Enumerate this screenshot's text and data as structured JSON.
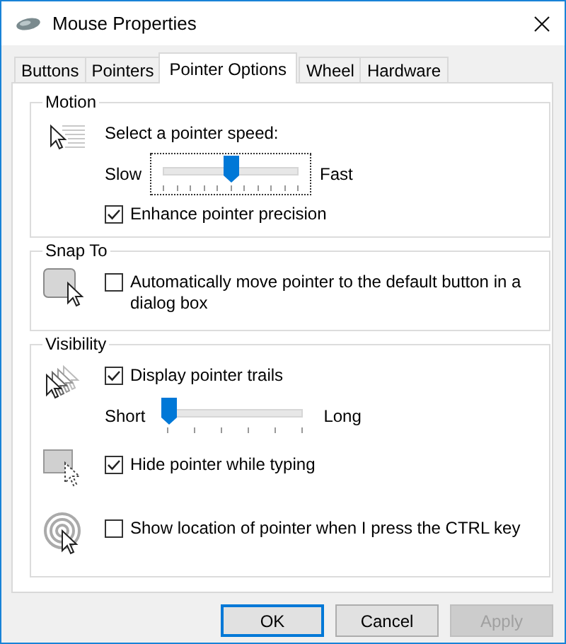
{
  "window": {
    "title": "Mouse Properties"
  },
  "tabs": [
    {
      "label": "Buttons",
      "selected": false
    },
    {
      "label": "Pointers",
      "selected": false
    },
    {
      "label": "Pointer Options",
      "selected": true
    },
    {
      "label": "Wheel",
      "selected": false
    },
    {
      "label": "Hardware",
      "selected": false
    }
  ],
  "groups": [
    {
      "title": "Motion",
      "rows": [
        {
          "controls": [
            {
              "kind": "label",
              "text": "Select a pointer speed:"
            },
            {
              "kind": "slider",
              "min_label": "Slow",
              "max_label": "Fast",
              "level": 0.5,
              "focused": true
            },
            {
              "kind": "checkbox",
              "label": "Enhance pointer precision",
              "checked": true
            }
          ]
        }
      ]
    },
    {
      "title": "Snap To",
      "rows": [
        {
          "controls": [
            {
              "kind": "checkbox",
              "label": "Automatically move pointer to the default button in a dialog box",
              "checked": false
            }
          ]
        }
      ]
    },
    {
      "title": "Visibility",
      "rows": [
        {
          "controls": [
            {
              "kind": "checkbox",
              "label": "Display pointer trails",
              "checked": true
            },
            {
              "kind": "slider",
              "min_label": "Short",
              "max_label": "Long",
              "level": 0,
              "focused": false
            }
          ]
        },
        {
          "controls": [
            {
              "kind": "checkbox",
              "label": "Hide pointer while typing",
              "checked": true
            }
          ]
        },
        {
          "controls": [
            {
              "kind": "checkbox",
              "label": "Show location of pointer when I press the CTRL key",
              "checked": false
            }
          ]
        }
      ]
    }
  ],
  "buttons": [
    {
      "label": "OK",
      "default": true,
      "disabled": false
    },
    {
      "label": "Cancel",
      "default": false,
      "disabled": false
    },
    {
      "label": "Apply",
      "default": false,
      "disabled": true
    }
  ]
}
